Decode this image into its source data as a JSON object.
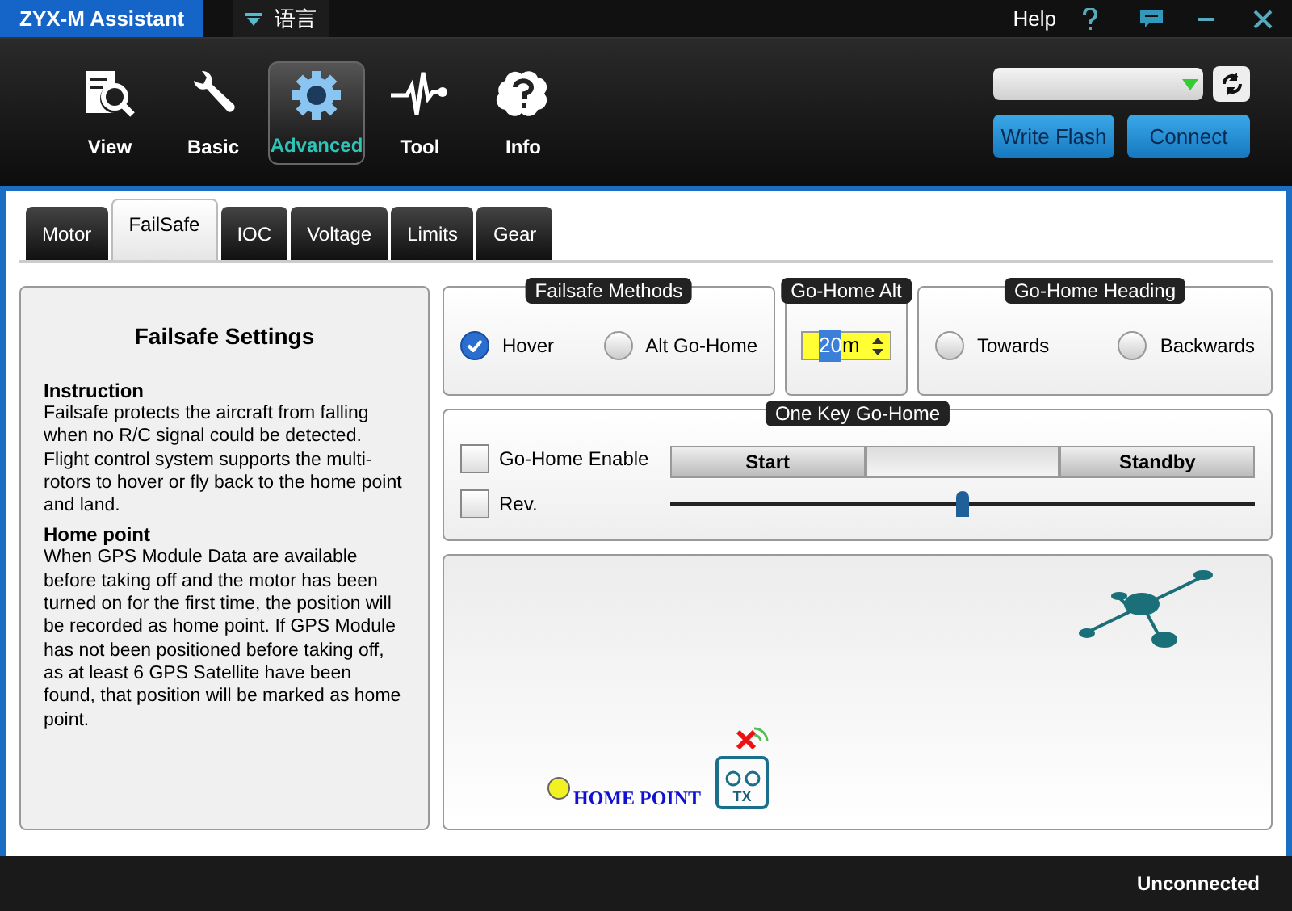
{
  "app_title": "ZYX-M Assistant",
  "language_menu": {
    "label": "语言"
  },
  "help": {
    "label": "Help"
  },
  "toolbar": [
    {
      "label": "View",
      "kind": "view",
      "selected": false
    },
    {
      "label": "Basic",
      "kind": "basic",
      "selected": false
    },
    {
      "label": "Advanced",
      "kind": "advanced",
      "selected": true
    },
    {
      "label": "Tool",
      "kind": "tool",
      "selected": false
    },
    {
      "label": "Info",
      "kind": "info",
      "selected": false
    }
  ],
  "buttons": [
    "Write Flash",
    "Connect"
  ],
  "tabs": [
    {
      "label": "Motor",
      "selected": false
    },
    {
      "label": "FailSafe",
      "selected": true
    },
    {
      "label": "IOC",
      "selected": false
    },
    {
      "label": "Voltage",
      "selected": false
    },
    {
      "label": "Limits",
      "selected": false
    },
    {
      "label": "Gear",
      "selected": false
    }
  ],
  "info_panel": {
    "title": "Failsafe Settings",
    "sections": [
      {
        "heading": "Instruction",
        "text": "Failsafe protects the aircraft from falling when no R/C signal could be detected. Flight control system supports the multi-rotors to hover or fly back to the home point and land."
      },
      {
        "heading": "Home point",
        "text": "When GPS Module Data are available before taking off and the motor has been turned on for the first time, the position will be recorded as home point. If GPS Module has not been positioned before taking off, as at least 6 GPS Satellite have been found, that position will be marked as home point."
      }
    ]
  },
  "failsafe_methods": {
    "title": "Failsafe Methods",
    "options": [
      {
        "label": "Hover",
        "selected": true
      },
      {
        "label": "Alt Go-Home",
        "selected": false
      }
    ]
  },
  "go_home_alt": {
    "title": "Go-Home Alt",
    "value": "20",
    "unit": "m"
  },
  "go_home_heading": {
    "title": "Go-Home Heading",
    "options": [
      {
        "label": "Towards",
        "selected": false
      },
      {
        "label": "Backwards",
        "selected": false
      }
    ]
  },
  "one_key_go_home": {
    "title": "One Key Go-Home",
    "checkboxes": [
      {
        "label": "Go-Home Enable",
        "checked": false
      },
      {
        "label": "Rev.",
        "checked": false
      }
    ],
    "segments": [
      {
        "label": "Start"
      },
      {
        "label": "Standby"
      }
    ],
    "level": 0.5
  },
  "illustration": {
    "home_point": "HOME POINT",
    "tx": "TX"
  },
  "status_bar": "Unconnected"
}
